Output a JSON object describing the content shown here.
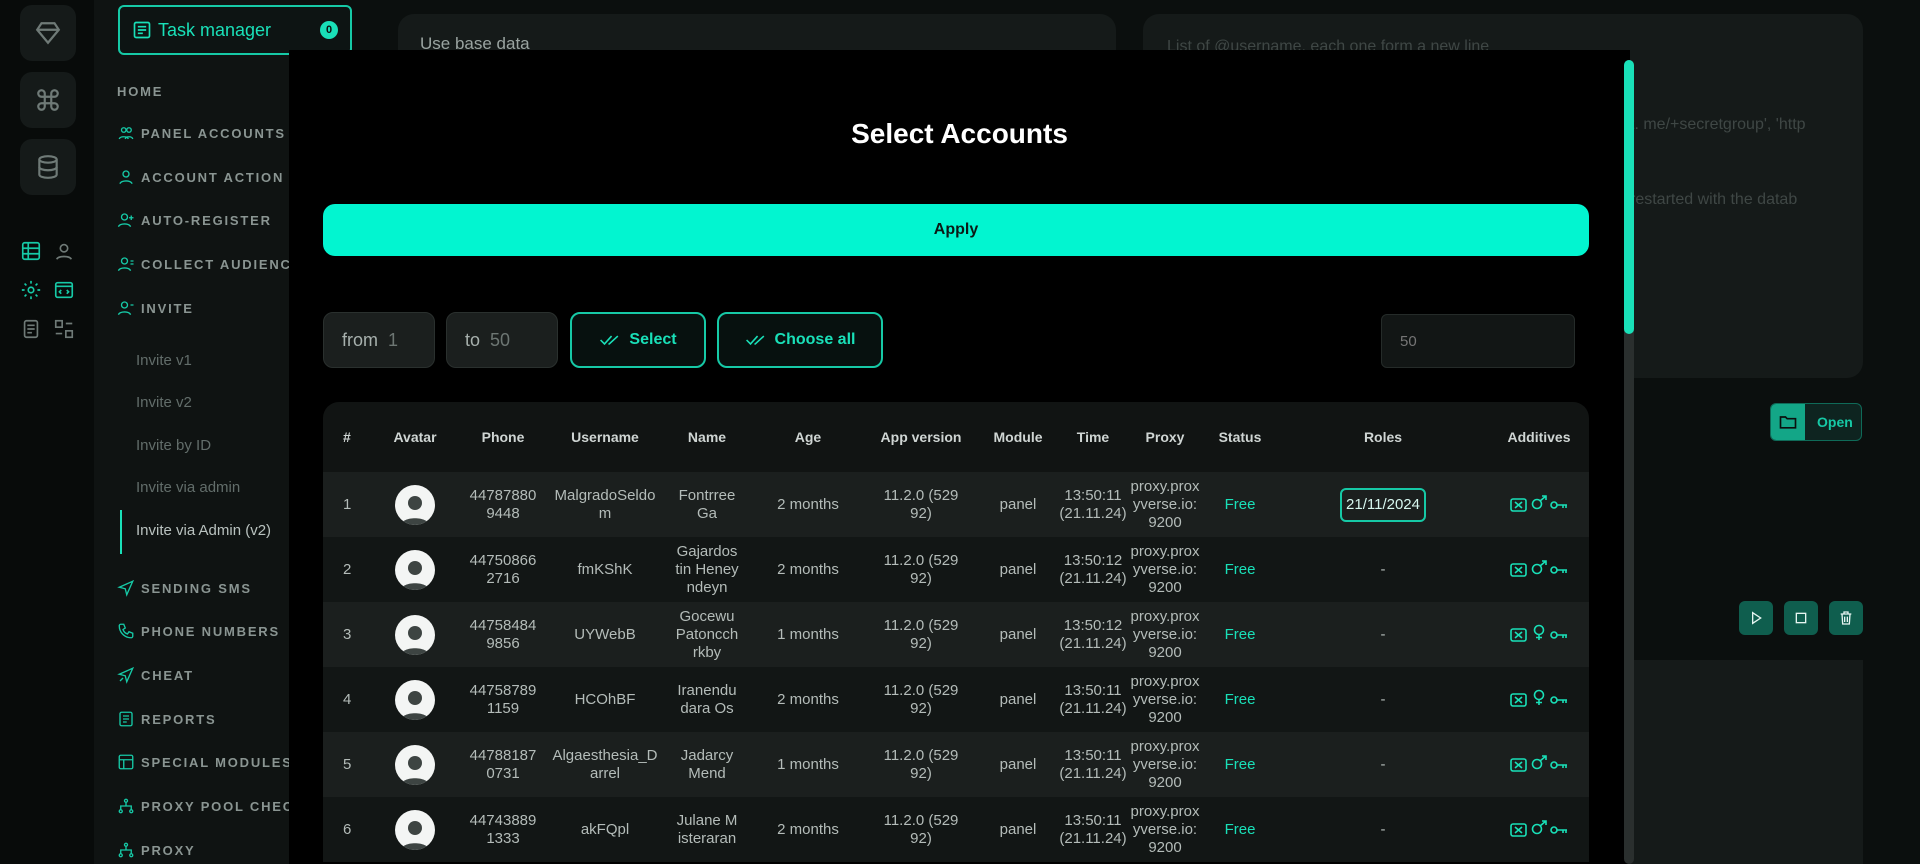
{
  "sidebar": {
    "task_manager": {
      "label": "Task manager",
      "count": "0"
    },
    "nav": {
      "home": "HOME",
      "panel_accounts": "PANEL ACCOUNTS",
      "account_action": "ACCOUNT ACTION",
      "auto_register": "AUTO-REGISTER",
      "collect_audience": "COLLECT AUDIENCE",
      "invite": "INVITE",
      "sending_sms": "SENDING SMS",
      "phone_numbers": "PHONE NUMBERS",
      "cheat": "CHEAT",
      "reports": "REPORTS",
      "special_modules": "SPECIAL MODULES",
      "proxy_pool_check": "PROXY POOL CHECK",
      "proxy": "PROXY"
    },
    "invite_sub": [
      "Invite v1",
      "Invite v2",
      "Invite by ID",
      "Invite via admin",
      "Invite via Admin (v2)"
    ]
  },
  "background": {
    "use_base_data": "Use base data",
    "usernames_placeholder": "List of @username, each one form a new line",
    "text_fragment_1": "t. me/+secretgroup', 'http",
    "text_fragment_2": "restarted with the datab",
    "open_label": "Open"
  },
  "modal": {
    "title": "Select Accounts",
    "apply_label": "Apply",
    "from_label": "from",
    "from_value": "1",
    "to_label": "to",
    "to_value": "50",
    "select_label": "Select",
    "choose_all_label": "Choose all",
    "count_placeholder": "50"
  },
  "table": {
    "headers": [
      "#",
      "Avatar",
      "Phone",
      "Username",
      "Name",
      "Age",
      "App version",
      "Module",
      "Time",
      "Proxy",
      "Status",
      "Roles",
      "Additives"
    ],
    "rows": [
      {
        "num": "1",
        "phone": "447878809448",
        "username": "MalgradoSeldom",
        "name": "Fontrree Ga",
        "age": "2 months",
        "app": "11.2.0 (52992)",
        "module": "panel",
        "time": "13:50:11(21.11.24)",
        "proxy": "proxy.proxyverse.io:9200",
        "status": "Free",
        "roles": "21/11/2024",
        "gender": "male"
      },
      {
        "num": "2",
        "phone": "447508662716",
        "username": "fmKShK",
        "name": "Gajardostin Heneyndeyn",
        "age": "2 months",
        "app": "11.2.0 (52992)",
        "module": "panel",
        "time": "13:50:12 (21.11.24)",
        "proxy": "proxy.proxyverse.io:9200",
        "status": "Free",
        "roles": "-",
        "gender": "male"
      },
      {
        "num": "3",
        "phone": "447584849856",
        "username": "UYWebB",
        "name": "Gocewu Patoncchrkby",
        "age": "1 months",
        "app": "11.2.0 (52992)",
        "module": "panel",
        "time": "13:50:12 (21.11.24)",
        "proxy": "proxy.proxyverse.io:9200",
        "status": "Free",
        "roles": "-",
        "gender": "female"
      },
      {
        "num": "4",
        "phone": "447587891159",
        "username": "HCOhBF",
        "name": "Iranendudara Os",
        "age": "2 months",
        "app": "11.2.0 (52992)",
        "module": "panel",
        "time": "13:50:11(21.11.24)",
        "proxy": "proxy.proxyverse.io:9200",
        "status": "Free",
        "roles": "-",
        "gender": "female"
      },
      {
        "num": "5",
        "phone": "447881870731",
        "username": "Algaesthesia_Darrel",
        "name": "Jadarcy Mend",
        "age": "1 months",
        "app": "11.2.0 (52992)",
        "module": "panel",
        "time": "13:50:11(21.11.24)",
        "proxy": "proxy.proxyverse.io:9200",
        "status": "Free",
        "roles": "-",
        "gender": "male"
      },
      {
        "num": "6",
        "phone": "447438891333",
        "username": "akFQpl",
        "name": "Julane Misteraran",
        "age": "2 months",
        "app": "11.2.0 (52992)",
        "module": "panel",
        "time": "13:50:11(21.11.24)",
        "proxy": "proxy.proxyverse.io:9200",
        "status": "Free",
        "roles": "-",
        "gender": "male"
      }
    ]
  },
  "colors": {
    "accent": "#19e0b8",
    "apply": "#02f5d0",
    "modal_bg": "#000000",
    "page_bg": "#0b0f0e"
  }
}
